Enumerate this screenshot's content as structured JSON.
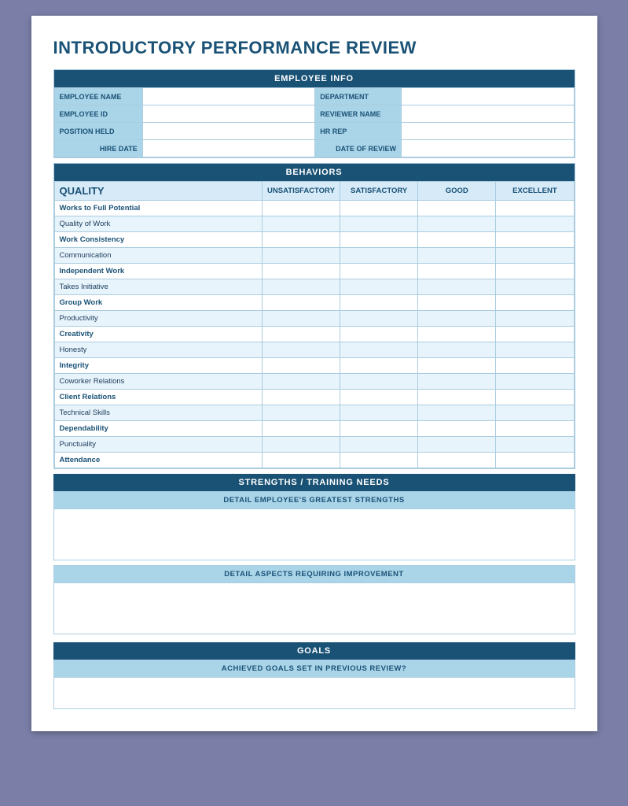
{
  "title": "INTRODUCTORY PERFORMANCE REVIEW",
  "employee_info": {
    "header": "EMPLOYEE INFO",
    "fields": [
      {
        "label": "EMPLOYEE NAME",
        "value": ""
      },
      {
        "label": "DEPARTMENT",
        "value": ""
      },
      {
        "label": "EMPLOYEE ID",
        "value": ""
      },
      {
        "label": "REVIEWER NAME",
        "value": ""
      },
      {
        "label": "POSITION HELD",
        "value": ""
      },
      {
        "label": "HR REP",
        "value": ""
      },
      {
        "label": "HIRE DATE",
        "value": ""
      },
      {
        "label": "DATE OF REVIEW",
        "value": ""
      }
    ]
  },
  "behaviors": {
    "header": "BEHAVIORS",
    "columns": [
      "QUALITY",
      "UNSATISFACTORY",
      "SATISFACTORY",
      "GOOD",
      "EXCELLENT"
    ],
    "rows": [
      "Works to Full Potential",
      "Quality of Work",
      "Work Consistency",
      "Communication",
      "Independent Work",
      "Takes Initiative",
      "Group Work",
      "Productivity",
      "Creativity",
      "Honesty",
      "Integrity",
      "Coworker Relations",
      "Client Relations",
      "Technical Skills",
      "Dependability",
      "Punctuality",
      "Attendance"
    ]
  },
  "strengths": {
    "header": "STRENGTHS / TRAINING NEEDS",
    "strengths_label": "DETAIL EMPLOYEE'S GREATEST STRENGTHS",
    "improvement_label": "DETAIL ASPECTS REQUIRING IMPROVEMENT"
  },
  "goals": {
    "header": "GOALS",
    "achieved_label": "ACHIEVED GOALS SET IN PREVIOUS REVIEW?"
  }
}
